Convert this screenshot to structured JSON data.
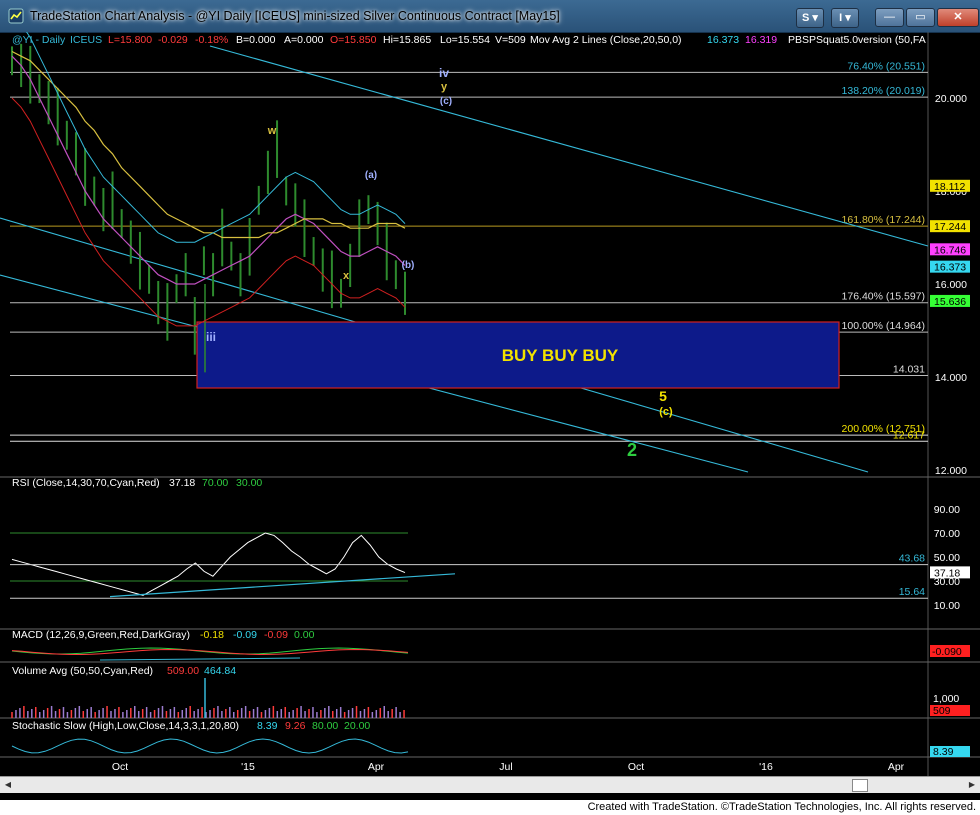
{
  "window": {
    "title": "TradeStation Chart Analysis - @YI Daily [ICEUS] mini-sized Silver Continuous Contract [May15]",
    "btn_s": "S",
    "btn_i": "I",
    "footer": "Created with TradeStation. ©TradeStation Technologies, Inc. All rights reserved."
  },
  "colors": {
    "bg": "#000000",
    "price": "#2e8b2e",
    "cyan": "#35b9d8",
    "yellow": "#f2e200",
    "red": "#ff3b3b",
    "green": "#2ecc40",
    "white": "#ffffff",
    "magenta": "#c050c0",
    "navy": "#0d1a8a"
  },
  "header": {
    "sym": "@YI - Daily",
    "exch": "ICEUS",
    "last": "L=15.800",
    "chg": "-0.029",
    "pct": "-0.18%",
    "bid": "B=0.000",
    "ask": "A=0.000",
    "open": "O=15.850",
    "hi": "Hi=15.865",
    "lo": "Lo=15.554",
    "vol": "V=509",
    "ma_label": "Mov Avg 2 Lines (Close,20,50,0)",
    "ma1": "16.373",
    "ma2": "16.319",
    "pbs": "PBSPSquat5.0version (50,FA"
  },
  "chart_data": [
    {
      "type": "line",
      "panel": "price",
      "ylim": [
        11.0,
        21.0
      ],
      "y_ticks": [
        "20.000",
        "18.000",
        "16.000",
        "14.000",
        "12.000"
      ],
      "x_ticks": [
        "Oct",
        "'15",
        "Apr",
        "Jul",
        "Oct",
        "'16",
        "Apr"
      ],
      "price_markers": [
        {
          "label": "18.112",
          "value": 18.112,
          "color": "#f2e200"
        },
        {
          "label": "17.244",
          "value": 17.244,
          "color": "#f2e200"
        },
        {
          "label": "16.746",
          "value": 16.746,
          "color": "#ff40ff"
        },
        {
          "label": "16.373",
          "value": 16.373,
          "color": "#35d8f0"
        },
        {
          "label": "15.636",
          "value": 15.636,
          "color": "#35ff35"
        }
      ],
      "fib_levels": [
        {
          "label": "76.40% (20.551)",
          "value": 20.551
        },
        {
          "label": "138.20% (20.019)",
          "value": 20.019
        },
        {
          "label": "161.80% (17.244)",
          "value": 17.244
        },
        {
          "label": "176.40% (15.597)",
          "value": 15.597
        },
        {
          "label": "100.00% (14.964)",
          "value": 14.964
        },
        {
          "label": "14.031",
          "value": 14.031
        },
        {
          "label": "200.00% (12.751)",
          "value": 12.751
        },
        {
          "label": "12.617",
          "value": 12.617
        }
      ],
      "wave_labels": [
        "iv",
        "y",
        "(c)",
        "w",
        "(a)",
        "(b)",
        "x",
        "iii",
        "5",
        "(c)",
        "2"
      ],
      "box_label": "BUY BUY BUY",
      "price_series": [
        20.8,
        20.7,
        20.5,
        20.2,
        19.9,
        19.6,
        19.2,
        18.8,
        18.3,
        18.0,
        17.6,
        17.8,
        17.3,
        16.9,
        16.5,
        16.1,
        15.6,
        15.4,
        15.9,
        16.2,
        15.1,
        16.5,
        16.2,
        17.0,
        16.6,
        16.2,
        16.8,
        17.8,
        18.4,
        18.9,
        18.0,
        17.7,
        17.2,
        16.7,
        16.3,
        16.1,
        15.8,
        16.4,
        17.2,
        17.6,
        17.3,
        16.7,
        16.2,
        15.8
      ],
      "ma20": [
        20.9,
        20.7,
        20.4,
        20.0,
        19.6,
        19.2,
        18.8,
        18.4,
        18.0,
        17.7,
        17.4,
        17.2,
        17.0,
        16.8,
        16.6,
        16.4,
        16.2,
        16.1,
        16.0,
        16.0,
        16.0,
        16.1,
        16.2,
        16.3,
        16.4,
        16.5,
        16.6,
        16.8,
        17.0,
        17.2,
        17.4,
        17.5,
        17.4,
        17.3,
        17.1,
        16.9,
        16.7,
        16.6,
        16.6,
        16.7,
        16.8,
        16.7,
        16.6,
        16.4
      ],
      "ma50": [
        21.0,
        20.9,
        20.8,
        20.6,
        20.4,
        20.2,
        20.0,
        19.8,
        19.5,
        19.3,
        19.0,
        18.8,
        18.5,
        18.3,
        18.1,
        17.9,
        17.7,
        17.5,
        17.4,
        17.3,
        17.2,
        17.1,
        17.1,
        17.0,
        17.0,
        17.0,
        17.0,
        17.0,
        17.1,
        17.1,
        17.2,
        17.3,
        17.4,
        17.4,
        17.4,
        17.3,
        17.3,
        17.2,
        17.2,
        17.2,
        17.3,
        17.3,
        17.3,
        17.2
      ]
    },
    {
      "type": "line",
      "panel": "rsi",
      "label": "RSI (Close,14,30,70,Cyan,Red)",
      "value": "37.18",
      "ob": "70.00",
      "os": "30.00",
      "y_ticks": [
        "90.00",
        "70.00",
        "50.00",
        "30.00",
        "10.00"
      ],
      "levels": [
        {
          "label": "43.68",
          "value": 43.68
        },
        {
          "label": "15.64",
          "value": 15.64
        }
      ],
      "values": [
        48,
        46,
        44,
        42,
        40,
        38,
        36,
        34,
        32,
        30,
        28,
        26,
        24,
        22,
        20,
        18,
        22,
        26,
        30,
        34,
        40,
        45,
        38,
        34,
        42,
        50,
        56,
        62,
        66,
        70,
        68,
        62,
        55,
        50,
        44,
        40,
        36,
        40,
        50,
        62,
        68,
        60,
        50,
        44,
        40,
        37
      ]
    },
    {
      "type": "line",
      "panel": "macd",
      "label": "MACD (12,26,9,Green,Red,DarkGray)",
      "v1": "-0.18",
      "v2": "-0.09",
      "v3": "-0.09",
      "v4": "0.00",
      "value_box": "-0.090"
    },
    {
      "type": "bar",
      "panel": "volume",
      "label": "Volume Avg (50,50,Cyan,Red)",
      "v1": "509.00",
      "v2": "464.84",
      "y_tick": "1,000",
      "value_box": "509"
    },
    {
      "type": "line",
      "panel": "stochastic",
      "label": "Stochastic Slow (High,Low,Close,14,3,3,1,20,80)",
      "v1": "8.39",
      "v2": "9.26",
      "v3": "80.00",
      "v4": "20.00",
      "value_box": "8.39"
    }
  ]
}
